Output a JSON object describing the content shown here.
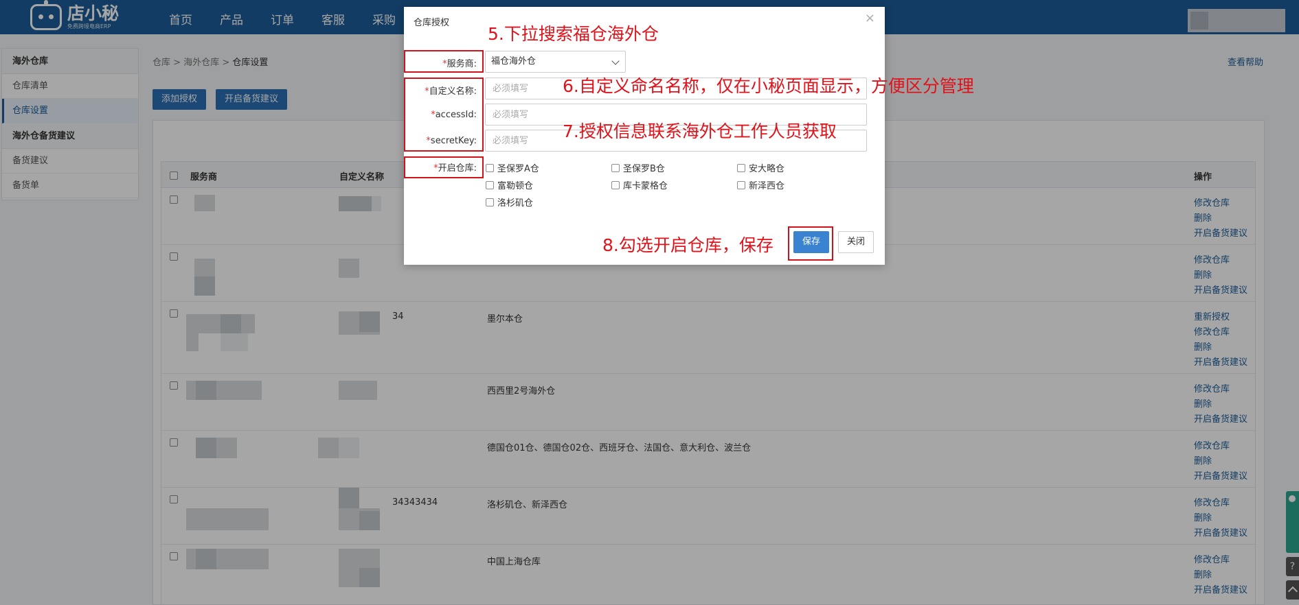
{
  "app": {
    "logo_text": "店小秘",
    "logo_sub": "免费跨境电商ERP"
  },
  "nav": [
    "首页",
    "产品",
    "订单",
    "客服",
    "采购"
  ],
  "sidebar": {
    "group1": "海外仓库",
    "item1": "仓库清单",
    "item2": "仓库设置",
    "group2": "海外仓备货建议",
    "item3": "备货建议",
    "item4": "备货单"
  },
  "breadcrumb": {
    "b1": "仓库",
    "sep": " > ",
    "b2": "海外仓库",
    "b3": "仓库设置"
  },
  "help_link": "查看帮助",
  "buttons": {
    "add_auth": "添加授权",
    "enable_suggest": "开启备货建议"
  },
  "table": {
    "headers": {
      "provider": "服务商",
      "custom_name": "自定义名称",
      "ops": "操作"
    },
    "rows": [
      {
        "code": "",
        "warehouse": "",
        "ops": [
          "修改仓库",
          "删除",
          "开启备货建议"
        ]
      },
      {
        "code": "",
        "warehouse": "",
        "ops": [
          "修改仓库",
          "删除",
          "开启备货建议"
        ]
      },
      {
        "code": "34",
        "warehouse": "墨尔本仓",
        "ops": [
          "重新授权",
          "修改仓库",
          "删除",
          "开启备货建议"
        ]
      },
      {
        "code": "",
        "warehouse": "西西里2号海外仓",
        "ops": [
          "修改仓库",
          "删除",
          "开启备货建议"
        ]
      },
      {
        "code": "",
        "warehouse": "德国仓01仓、德国仓02仓、西班牙仓、法国仓、意大利仓、波兰仓",
        "ops": [
          "修改仓库",
          "删除",
          "开启备货建议"
        ]
      },
      {
        "code": "34343434",
        "warehouse": "洛杉矶仓、新泽西仓",
        "ops": [
          "修改仓库",
          "删除",
          "开启备货建议"
        ]
      },
      {
        "code": "",
        "warehouse": "中国上海仓库",
        "ops": [
          "修改仓库",
          "删除",
          "开启备货建议"
        ]
      }
    ]
  },
  "modal": {
    "title": "仓库授权",
    "close": "×",
    "req_mark": "*",
    "provider_label": "服务商:",
    "provider_value": "福仓海外仓",
    "name_label": "自定义名称:",
    "access_label": "accessId:",
    "secret_label": "secretKey:",
    "placeholder": "必须填写",
    "warehouse_label": "开启仓库:",
    "warehouses": [
      "圣保罗A仓",
      "圣保罗B仓",
      "安大略仓",
      "富勒顿仓",
      "库卡蒙格仓",
      "新泽西仓",
      "洛杉矶仓"
    ],
    "save": "保存",
    "cancel": "关闭"
  },
  "annotations": {
    "a5": "5.下拉搜索福仓海外仓",
    "a6": "6.自定义命名名称，仅在小秘页面显示，方便区分管理",
    "a7": "7.授权信息联系海外仓工作人员获取",
    "a8": "8.勾选开启仓库，保存"
  },
  "colors": {
    "header_blue": "#1d5c98",
    "annotation_red": "#e0121a",
    "save_blue": "#3a83d0"
  }
}
